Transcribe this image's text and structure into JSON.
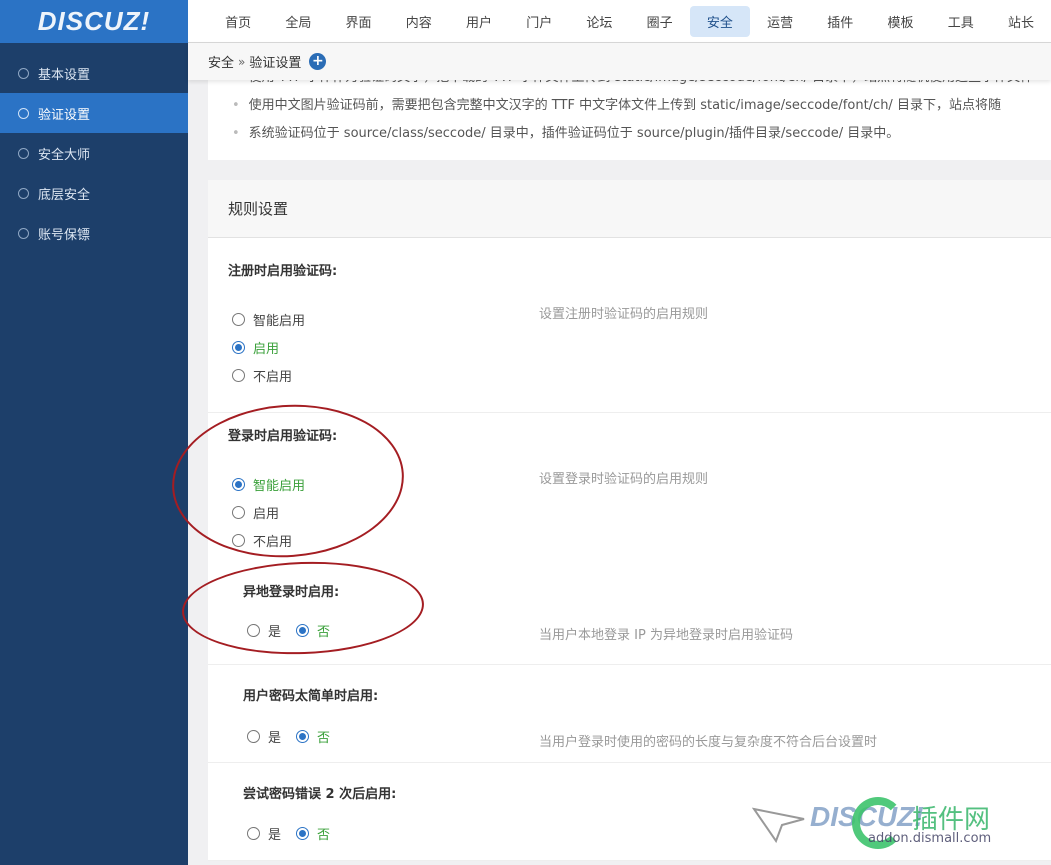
{
  "logo": "DISCUZ!",
  "topnav": {
    "items": [
      "首页",
      "全局",
      "界面",
      "内容",
      "用户",
      "门户",
      "论坛",
      "圈子",
      "安全",
      "运营",
      "插件",
      "模板",
      "工具",
      "站长"
    ],
    "active_index": 8
  },
  "sidebar": {
    "items": [
      "基本设置",
      "验证设置",
      "安全大师",
      "底层安全",
      "账号保镖"
    ],
    "active_index": 1
  },
  "breadcrumb": {
    "parent": "安全",
    "separator": "»",
    "current": "验证设置",
    "add_icon": "plus-circle-icon"
  },
  "tips": [
    "使用 TTF 字体作为验证码文字，把下载的 TTF 字体文件上传到 static/image/seccode/font/en/ 目录下，站点将随机使用这些字体文件",
    "使用中文图片验证码前，需要把包含完整中文汉字的 TTF 中文字体文件上传到 static/image/seccode/font/ch/ 目录下，站点将随",
    "系统验证码位于 source/class/seccode/ 目录中，插件验证码位于 source/plugin/插件目录/seccode/ 目录中。"
  ],
  "panel": {
    "title": "规则设置",
    "rows": [
      {
        "title": "注册时启用验证码:",
        "options": [
          "智能启用",
          "启用",
          "不启用"
        ],
        "selected": 1,
        "desc": "设置注册时验证码的启用规则"
      },
      {
        "title": "登录时启用验证码:",
        "options": [
          "智能启用",
          "启用",
          "不启用"
        ],
        "selected": 0,
        "desc": "设置登录时验证码的启用规则"
      },
      {
        "title": "异地登录时启用:",
        "options": [
          "是",
          "否"
        ],
        "selected": 1,
        "desc": "当用户本地登录 IP 为异地登录时启用验证码"
      },
      {
        "title": "用户密码太简单时启用:",
        "options": [
          "是",
          "否"
        ],
        "selected": 1,
        "desc": "当用户登录时使用的密码的长度与复杂度不符合后台设置时"
      },
      {
        "title": "尝试密码错误 2 次后启用:",
        "options": [
          "是",
          "否"
        ],
        "selected": 1,
        "desc": ""
      }
    ]
  },
  "watermark": {
    "brand": "DISCUZ!",
    "cn": "插件网",
    "url": "addon.dismall.com"
  },
  "colors": {
    "brand_blue": "#2b73c5",
    "sidebar_bg": "#1d3f6a",
    "checked_label": "#3aa03a",
    "annotation_red": "#a41d22"
  }
}
